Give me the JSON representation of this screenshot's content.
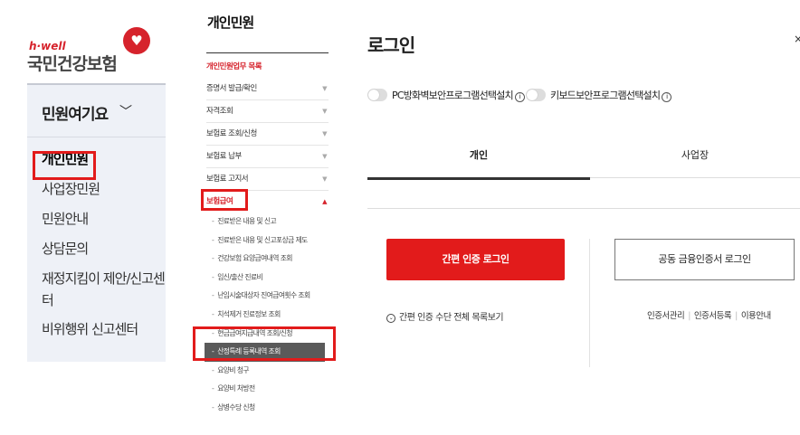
{
  "logo": {
    "sub": "h·well",
    "main": "국민건강보험"
  },
  "sidebar": {
    "category": "민원여기요",
    "items": [
      {
        "label": "개인민원"
      },
      {
        "label": "사업장민원"
      },
      {
        "label": "민원안내"
      },
      {
        "label": "상담문의"
      },
      {
        "label": "재정지킴이 제안/신고센터"
      },
      {
        "label": "비위행위 신고센터"
      }
    ]
  },
  "middle": {
    "title": "개인민원",
    "section_header": "개인민원업무 목록",
    "items": [
      {
        "label": "증명서 발급/확인"
      },
      {
        "label": "자격조회"
      },
      {
        "label": "보험료 조회/신청"
      },
      {
        "label": "보험료 납부"
      },
      {
        "label": "보험료 고지서"
      },
      {
        "label": "보험급여"
      }
    ],
    "sub_items": [
      {
        "label": "진료받은 내용 및 신고"
      },
      {
        "label": "진료받은 내용 및 신고포상금 제도"
      },
      {
        "label": "건강보험 요양급여내역 조회"
      },
      {
        "label": "임신/출산 진료비"
      },
      {
        "label": "난임시술대상자 진여급여횟수 조회"
      },
      {
        "label": "치석제거 진료정보 조회"
      },
      {
        "label": "현금급여지급내역 조회/신청"
      },
      {
        "label": "산정특례 등록내역 조회"
      },
      {
        "label": "요양비 청구"
      },
      {
        "label": "요양비 처방전"
      },
      {
        "label": "상병수당 신청"
      }
    ]
  },
  "login": {
    "title": "로그인",
    "toggle_firewall": "PC방화벽보안프로그램선택설치",
    "toggle_keyboard": "키보드보안프로그램선택설치",
    "info_glyph": "i",
    "tab_personal": "개인",
    "tab_business": "사업장",
    "easy_button": "간편 인증 로그인",
    "cert_button": "공동 금융인증서 로그인",
    "easy_list_link": "간편 인증 수단 전체 목록보기",
    "cert_links": [
      "인증서관리",
      "인증서등록",
      "이용안내"
    ]
  },
  "colors": {
    "accent": "#e21b1b",
    "sidebar_bg": "#eef1f7"
  }
}
